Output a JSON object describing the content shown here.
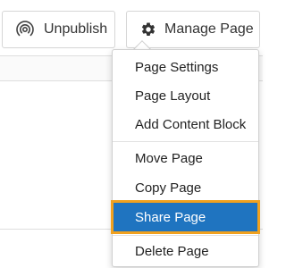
{
  "toolbar": {
    "unpublish_label": "Unpublish",
    "unpublish_icon": "broadcast-icon",
    "manage_label": "Manage Page",
    "manage_icon": "gear-icon"
  },
  "menu": {
    "items": [
      {
        "label": "Page Settings"
      },
      {
        "label": "Page Layout"
      },
      {
        "label": "Add Content Block"
      },
      {
        "label": "Move Page"
      },
      {
        "label": "Copy Page"
      },
      {
        "label": "Share Page",
        "state": "highlighted"
      },
      {
        "label": "Delete Page"
      }
    ]
  },
  "colors": {
    "highlight_background": "#1f74c0",
    "highlight_outline": "#f0a11f",
    "highlight_text": "#ffffff"
  }
}
